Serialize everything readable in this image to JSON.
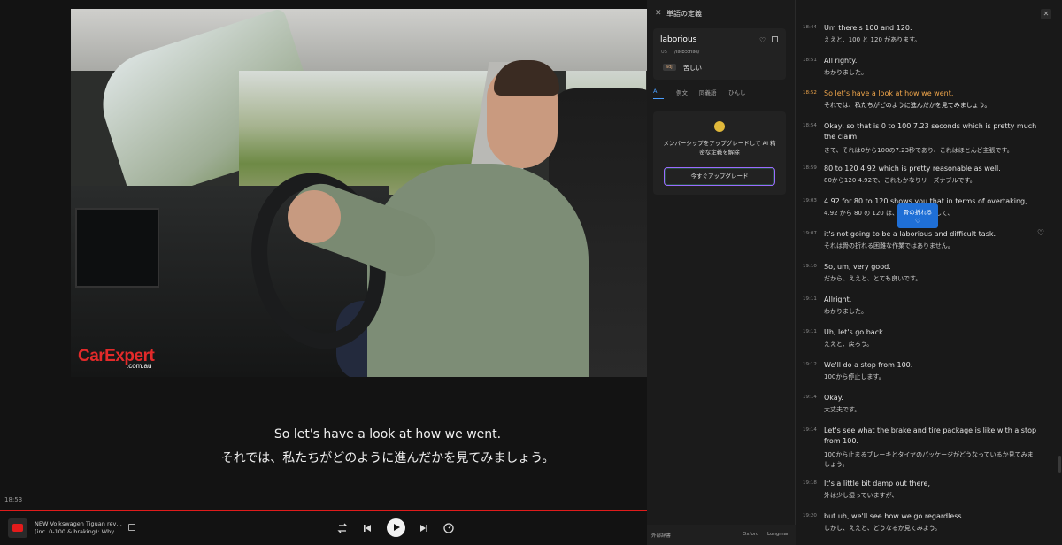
{
  "video": {
    "brand_main": "CarExpert",
    "brand_sub": ".com.au",
    "subtitle_en": "So let's have a look at how we went.",
    "subtitle_ja": "それでは、私たちがどのように進んだかを見てみましょう。",
    "current_time": "18:53",
    "progress_fraction": 1.0,
    "title_line1": "NEW Volkswagen Tiguan review",
    "title_line2": "(inc. 0-100 & braking): Why thi..."
  },
  "controls": {
    "loop_icon": "loop-icon",
    "prev_icon": "skip-previous-icon",
    "play_icon": "play-icon",
    "next_icon": "skip-next-icon",
    "speed_icon": "speed-icon"
  },
  "definition": {
    "panel_title": "単語の定義",
    "word": "laborious",
    "region": "US",
    "ipa": "/ləˈbɔːriəs/",
    "pos": "adj.",
    "meaning": "苦しい",
    "tabs": [
      "AI",
      "例文",
      "同義語",
      "ひんし"
    ],
    "active_tab": "AI",
    "promo_text": "メンバーシップをアップグレードして AI 精密な定義を解除",
    "upgrade_button": "今すぐアップグレード",
    "footer_left": "外部辞書",
    "footer_oxford": "Oxford",
    "footer_longman": "Longman"
  },
  "tooltip": {
    "text": "骨の折れる"
  },
  "transcript": [
    {
      "time": "18:44",
      "en": "Um there's 100 and 120.",
      "ja": "ええと、100 と 120 があります。",
      "active": false
    },
    {
      "time": "18:51",
      "en": "All righty.",
      "ja": "わかりました。",
      "active": false
    },
    {
      "time": "18:52",
      "en": "So let's have a look at how we went.",
      "ja": "それでは、私たちがどのように進んだかを見てみましょう。",
      "active": true
    },
    {
      "time": "18:54",
      "en": "Okay, so that is 0 to 100 7.23 seconds which is pretty much the claim.",
      "ja": "さて、それは0から100の7.23秒であり、これはほとんど主張です。",
      "active": false
    },
    {
      "time": "18:59",
      "en": "80 to 120 4.92 which is pretty reasonable as well.",
      "ja": "80から120 4.92で、これもかなりリーズナブルです。",
      "active": false
    },
    {
      "time": "19:03",
      "en": "4.92 for 80 to 120 shows you that in terms of overtaking,",
      "ja": "4.92 から 80 の 120 は、追い越しに関して、",
      "active": false
    },
    {
      "time": "19:07",
      "en": "it's not going to be a laborious and difficult task.",
      "ja": "それは骨の折れる困難な作業ではありません。",
      "active": false
    },
    {
      "time": "19:10",
      "en": "So, um, very good.",
      "ja": "だから、ええと、とても良いです。",
      "active": false
    },
    {
      "time": "19:11",
      "en": "Allright.",
      "ja": "わかりました。",
      "active": false
    },
    {
      "time": "19:11",
      "en": "Uh, let's go back.",
      "ja": "ええと、戻ろう。",
      "active": false
    },
    {
      "time": "19:12",
      "en": "We'll do a stop from 100.",
      "ja": "100から停止します。",
      "active": false
    },
    {
      "time": "19:14",
      "en": "Okay.",
      "ja": "大丈夫です。",
      "active": false
    },
    {
      "time": "19:14",
      "en": "Let's see what the brake and tire package is like with a stop from 100.",
      "ja": "100から止まるブレーキとタイヤのパッケージがどうなっているか見てみましょう。",
      "active": false
    },
    {
      "time": "19:18",
      "en": "It's a little bit damp out there,",
      "ja": "外は少し湿っていますが、",
      "active": false
    },
    {
      "time": "19:20",
      "en": "but uh, we'll see how we go regardless.",
      "ja": "しかし、ええと、どうなるか見てみよう。",
      "active": false
    }
  ]
}
